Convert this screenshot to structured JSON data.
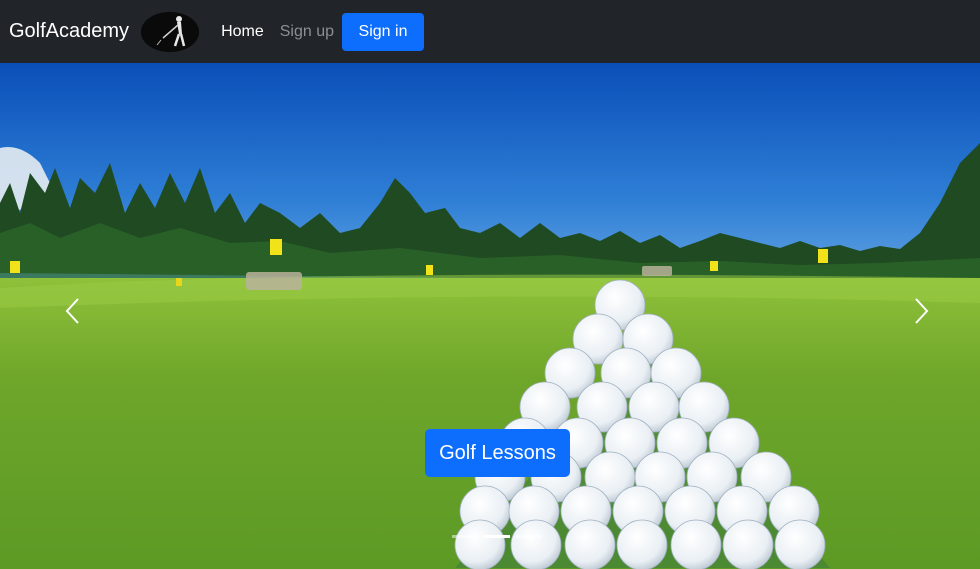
{
  "nav": {
    "brand": "GolfAcademy",
    "home": "Home",
    "signup": "Sign up",
    "signin": "Sign in"
  },
  "carousel": {
    "caption_button": "Golf Lessons",
    "active_slide": 2,
    "slide_count": 3
  },
  "colors": {
    "navbar_bg": "#212529",
    "primary": "#0d6efd"
  },
  "icons": {
    "prev": "chevron-left-icon",
    "next": "chevron-right-icon"
  }
}
